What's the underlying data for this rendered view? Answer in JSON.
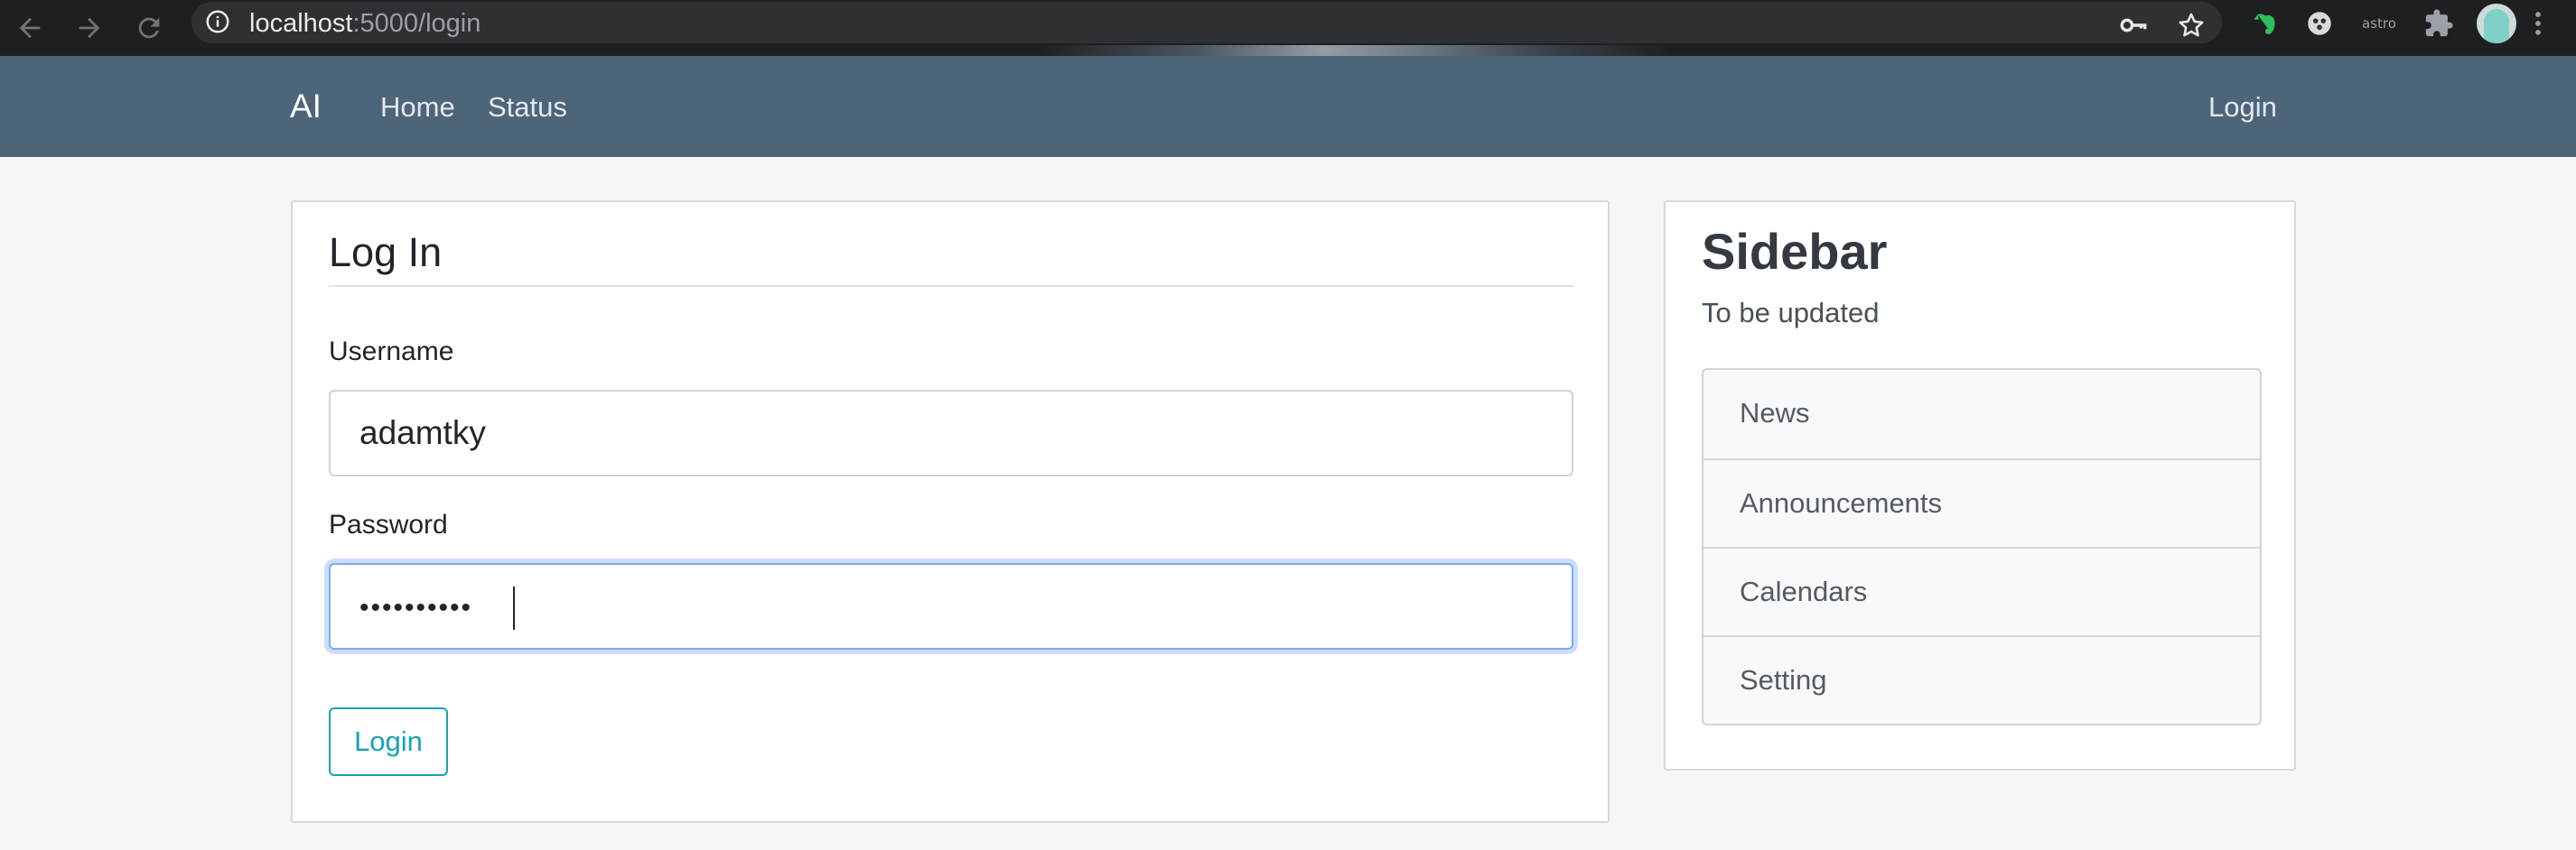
{
  "browser": {
    "url_host": "localhost",
    "url_rest": ":5000/login",
    "back_icon": "arrow-left-icon",
    "forward_icon": "arrow-right-icon",
    "reload_icon": "reload-icon",
    "info_icon": "info-icon",
    "key_icon": "key-icon",
    "star_icon": "star-icon",
    "extensions": [
      {
        "name": "evernote-extension-icon",
        "color": "#2dbe60"
      },
      {
        "name": "dice-extension-icon",
        "color": "#d9d9d9"
      },
      {
        "name": "astro-extension-icon",
        "label": "astro"
      },
      {
        "name": "puzzle-extension-icon",
        "color": "#9aa0a6"
      }
    ],
    "menu_icon": "more-vertical-icon"
  },
  "navbar": {
    "brand": "AI",
    "links": [
      "Home",
      "Status"
    ],
    "login_link": "Login",
    "background": "#4d6579"
  },
  "login_form": {
    "title": "Log In",
    "username_label": "Username",
    "username_value": "adamtky",
    "password_label": "Password",
    "password_masked": "••••••••••",
    "submit_label": "Login",
    "accent": "#17a2b8"
  },
  "sidebar": {
    "title": "Sidebar",
    "subtitle": "To be updated",
    "items": [
      "News",
      "Announcements",
      "Calendars",
      "Setting"
    ]
  }
}
